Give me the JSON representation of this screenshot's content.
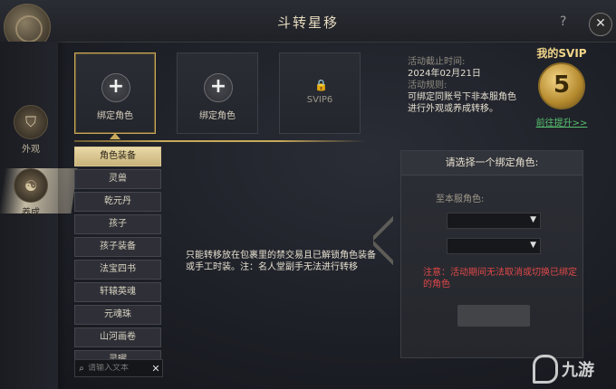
{
  "window": {
    "title": "斗转星移",
    "help_label": "?",
    "close_label": "✕"
  },
  "sidebar": {
    "tabs": [
      {
        "label": "外观",
        "icon": "robe-icon",
        "active": false
      },
      {
        "label": "养成",
        "icon": "figure-icon",
        "active": true
      }
    ]
  },
  "slots": [
    {
      "label": "绑定角色",
      "state": "add",
      "selected": true
    },
    {
      "label": "绑定角色",
      "state": "add",
      "selected": false
    },
    {
      "label": "SVIP6",
      "state": "locked",
      "selected": false
    }
  ],
  "event": {
    "deadline_label": "活动截止时间:",
    "deadline_value": "2024年02月21日",
    "rules_label": "活动规则:",
    "rules_text": "可绑定同账号下非本服角色进行外观或养成转移。"
  },
  "svip": {
    "title": "我的SVIP",
    "level": "5",
    "link": "前往提升>>"
  },
  "categories": {
    "items": [
      "角色装备",
      "灵兽",
      "乾元丹",
      "孩子",
      "孩子装备",
      "法宝四书",
      "轩辕英魂",
      "元魂珠",
      "山河画卷",
      "灵曜"
    ],
    "active_index": 0,
    "search_placeholder": "请输入文本",
    "search_value": ""
  },
  "description": "只能转移放在包裹里的禁交易且已解锁角色装备或手工时装。注：名人堂副手无法进行转移",
  "bind_panel": {
    "heading": "请选择一个绑定角色:",
    "server_label": "至本服角色:",
    "notice": "注意：活动期间无法取消或切换已绑定的角色"
  },
  "watermark": "九游",
  "colors": {
    "accent_gold": "#c8a95a",
    "warning_red": "#e04848",
    "link_green": "#58c26e"
  }
}
